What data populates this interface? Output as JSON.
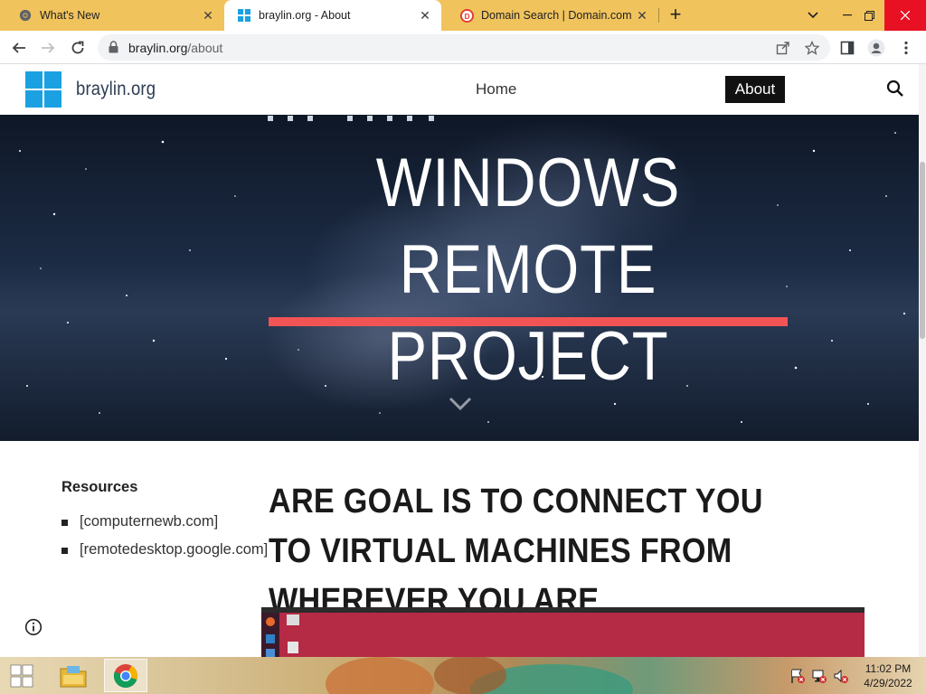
{
  "tabs": [
    {
      "title": "What's New",
      "favicon": "chrome-icon",
      "active": false
    },
    {
      "title": "braylin.org - About",
      "favicon": "windows-logo-icon",
      "active": true
    },
    {
      "title": "Domain Search | Domain.com",
      "favicon": "domain-com-icon",
      "active": false
    }
  ],
  "toolbar": {
    "url_host": "braylin.org",
    "url_path": "/about"
  },
  "site": {
    "name": "braylin.org",
    "nav": {
      "home": "Home",
      "about": "About"
    },
    "brand_color": "#1ba1e2"
  },
  "hero": {
    "title": "WINDOWS REMOTE PROJECT",
    "accent_color": "#f25454"
  },
  "sidebar": {
    "title": "Resources",
    "links": [
      "[computernewb.com]",
      "[remotedesktop.google.com]"
    ]
  },
  "main": {
    "heading": "ARE GOAL IS TO CONNECT YOU TO VIRTUAL MACHINES FROM WHEREVER YOU ARE"
  },
  "taskbar": {
    "time": "11:02 PM",
    "date": "4/29/2022"
  }
}
